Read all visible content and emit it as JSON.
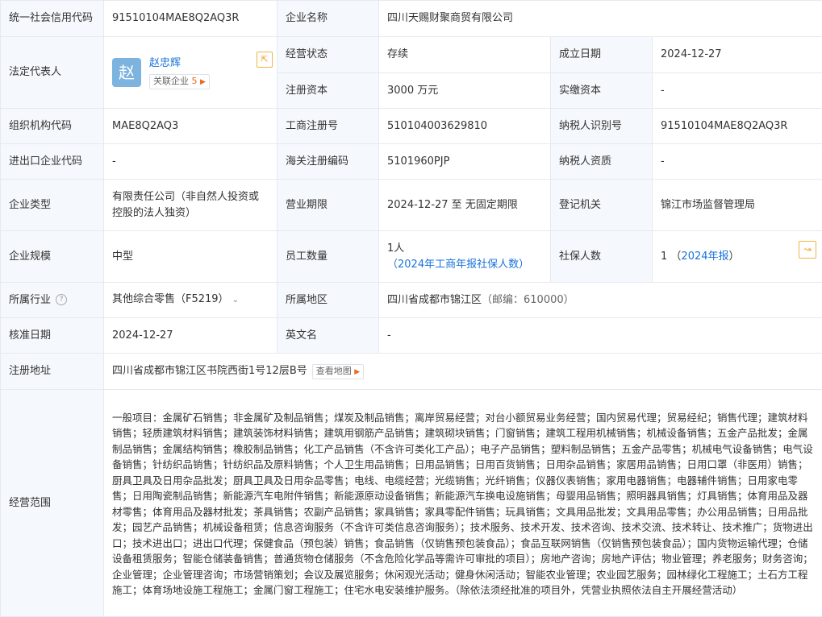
{
  "rows": {
    "credit_code": {
      "label": "统一社会信用代码",
      "value": "91510104MAE8Q2AQ3R"
    },
    "company_name": {
      "label": "企业名称",
      "value": "四川天赐财聚商贸有限公司"
    },
    "legal_rep": {
      "label": "法定代表人",
      "avatar_char": "赵",
      "name": "赵忠辉",
      "related_prefix": "关联企业",
      "related_count": "5"
    },
    "status": {
      "label": "经营状态",
      "value": "存续"
    },
    "established": {
      "label": "成立日期",
      "value": "2024-12-27"
    },
    "reg_capital": {
      "label": "注册资本",
      "value": "3000 万元"
    },
    "paid_capital": {
      "label": "实缴资本",
      "value": "-"
    },
    "org_code": {
      "label": "组织机构代码",
      "value": "MAE8Q2AQ3"
    },
    "biz_reg_no": {
      "label": "工商注册号",
      "value": "510104003629810"
    },
    "taxpayer_id": {
      "label": "纳税人识别号",
      "value": "91510104MAE8Q2AQ3R"
    },
    "import_export": {
      "label": "进出口企业代码",
      "value": "-"
    },
    "customs_code": {
      "label": "海关注册编码",
      "value": "5101960PJP"
    },
    "taxpayer_qual": {
      "label": "纳税人资质",
      "value": "-"
    },
    "company_type": {
      "label": "企业类型",
      "value": "有限责任公司（非自然人投资或控股的法人独资）"
    },
    "biz_term": {
      "label": "营业期限",
      "value": "2024-12-27 至 无固定期限"
    },
    "reg_authority": {
      "label": "登记机关",
      "value": "锦江市场监督管理局"
    },
    "scale": {
      "label": "企业规模",
      "value": "中型"
    },
    "employees": {
      "label": "员工数量",
      "value": "1人",
      "link": "（2024年工商年报社保人数）"
    },
    "insured": {
      "label": "社保人数",
      "value": "1",
      "link_open": "（",
      "link": "2024年报",
      "link_close": "）"
    },
    "industry": {
      "label": "所属行业",
      "value": "其他综合零售（F5219）"
    },
    "region": {
      "label": "所属地区",
      "value": "四川省成都市锦江区",
      "zip": "（邮编：610000）"
    },
    "approval_date": {
      "label": "核准日期",
      "value": "2024-12-27"
    },
    "english_name": {
      "label": "英文名",
      "value": "-"
    },
    "address": {
      "label": "注册地址",
      "value": "四川省成都市锦江区书院西街1号12层B号",
      "map_label": "查看地图"
    },
    "scope": {
      "label": "经营范围",
      "value": "一般项目：金属矿石销售；非金属矿及制品销售；煤炭及制品销售；离岸贸易经营；对台小额贸易业务经营；国内贸易代理；贸易经纪；销售代理；建筑材料销售；轻质建筑材料销售；建筑装饰材料销售；建筑用钢筋产品销售；建筑砌块销售；门窗销售；建筑工程用机械销售；机械设备销售；五金产品批发；金属制品销售；金属结构销售；橡胶制品销售；化工产品销售（不含许可类化工产品）；电子产品销售；塑料制品销售；五金产品零售；机械电气设备销售；电气设备销售；针纺织品销售；针纺织品及原料销售；个人卫生用品销售；日用品销售；日用百货销售；日用杂品销售；家居用品销售；日用口罩（非医用）销售；厨具卫具及日用杂品批发；厨具卫具及日用杂品零售；电线、电缆经营；光缆销售；光纤销售；仪器仪表销售；家用电器销售；电器辅件销售；日用家电零售；日用陶瓷制品销售；新能源汽车电附件销售；新能源原动设备销售；新能源汽车换电设施销售；母婴用品销售；照明器具销售；灯具销售；体育用品及器材零售；体育用品及器材批发；茶具销售；农副产品销售；家具销售；家具零配件销售；玩具销售；文具用品批发；文具用品零售；办公用品销售；日用品批发；园艺产品销售；机械设备租赁；信息咨询服务（不含许可类信息咨询服务）；技术服务、技术开发、技术咨询、技术交流、技术转让、技术推广；货物进出口；技术进出口；进出口代理；保健食品（预包装）销售；食品销售（仅销售预包装食品）；食品互联网销售（仅销售预包装食品）；国内货物运输代理；仓储设备租赁服务；智能仓储装备销售；普通货物仓储服务（不含危险化学品等需许可审批的项目）；房地产咨询；房地产评估；物业管理；养老服务；财务咨询；企业管理；企业管理咨询；市场营销策划；会议及展览服务；休闲观光活动；健身休闲活动；智能农业管理；农业园艺服务；园林绿化工程施工；土石方工程施工；体育场地设施工程施工；金属门窗工程施工；住宅水电安装维护服务。（除依法须经批准的项目外，凭营业执照依法自主开展经营活动）"
    }
  }
}
